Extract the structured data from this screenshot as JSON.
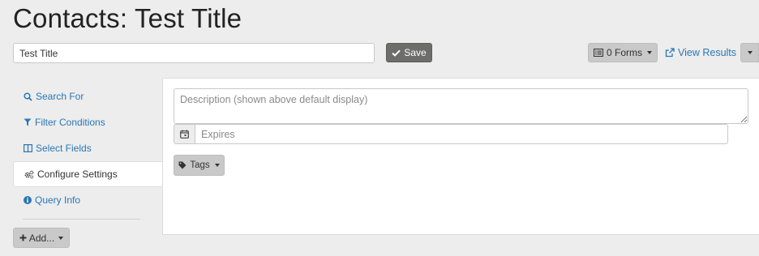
{
  "page": {
    "title": "Contacts: Test Title"
  },
  "toolbar": {
    "title_value": "Test Title",
    "save_label": "Save",
    "forms_label": "0 Forms",
    "view_results_label": "View Results"
  },
  "sidebar": {
    "items": [
      {
        "label": "Search For",
        "icon": "search-icon",
        "active": false
      },
      {
        "label": "Filter Conditions",
        "icon": "filter-icon",
        "active": false
      },
      {
        "label": "Select Fields",
        "icon": "columns-icon",
        "active": false
      },
      {
        "label": "Configure Settings",
        "icon": "cogs-icon",
        "active": true
      },
      {
        "label": "Query Info",
        "icon": "info-icon",
        "active": false
      }
    ],
    "add_label": "Add..."
  },
  "settings": {
    "description_placeholder": "Description (shown above default display)",
    "expires_placeholder": "Expires",
    "tags_label": "Tags"
  },
  "colors": {
    "link": "#2a77b5",
    "save_button": "#6d6e6a",
    "button_gray": "#c9c9c9",
    "background": "#ededed"
  }
}
